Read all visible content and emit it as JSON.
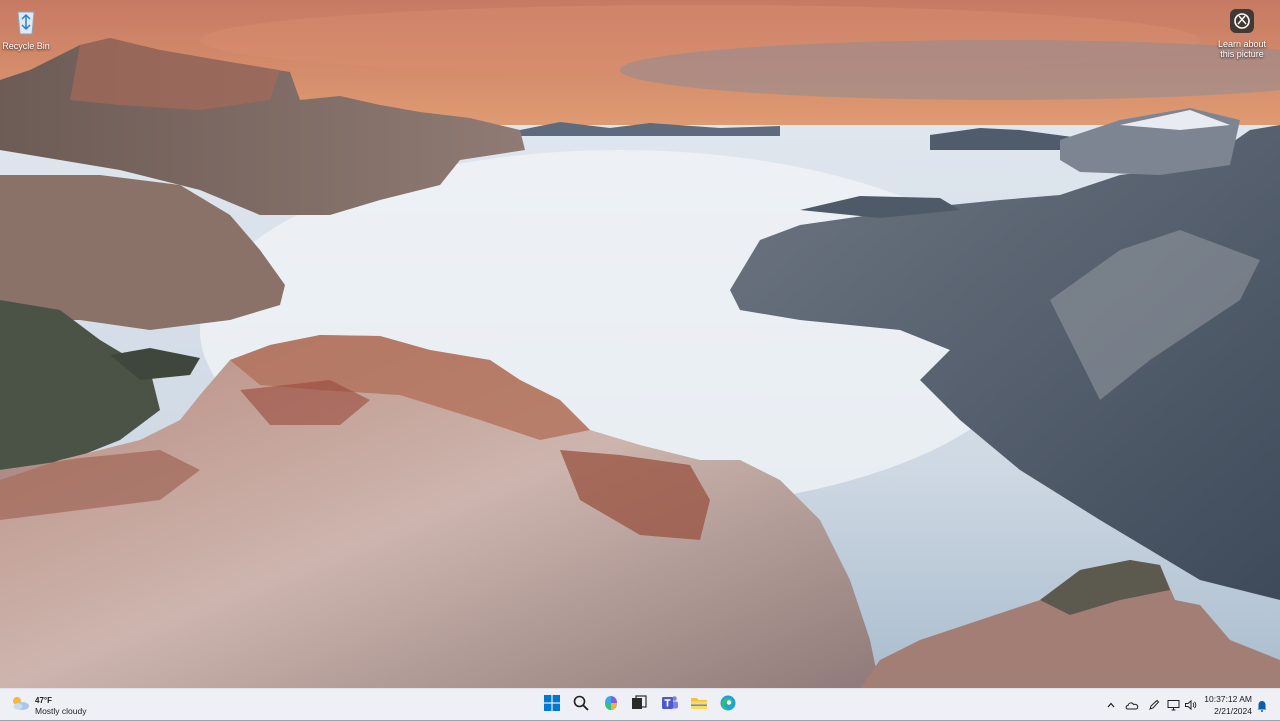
{
  "desktop": {
    "icons": [
      {
        "label": "Recycle Bin",
        "icon": "recycle-bin-icon"
      },
      {
        "label": "Learn about this picture",
        "icon": "camera-lens-icon"
      }
    ]
  },
  "taskbar": {
    "weather": {
      "temp": "47°F",
      "condition": "Mostly cloudy",
      "icon": "partly-cloudy-icon"
    },
    "apps": [
      {
        "name": "start",
        "icon": "windows-logo-icon"
      },
      {
        "name": "search",
        "icon": "search-icon"
      },
      {
        "name": "copilot",
        "icon": "copilot-icon"
      },
      {
        "name": "task-view",
        "icon": "task-view-icon"
      },
      {
        "name": "teams",
        "icon": "teams-icon"
      },
      {
        "name": "file-explorer",
        "icon": "folder-icon"
      },
      {
        "name": "edge",
        "icon": "edge-icon"
      }
    ],
    "tray": {
      "icons": [
        "chevron-up-icon",
        "onedrive-icon",
        "pen-icon",
        "network-icon",
        "volume-icon"
      ]
    },
    "clock": {
      "time": "10:37:12 AM",
      "date": "2/21/2024"
    },
    "notification_icon": "bell-icon"
  },
  "colors": {
    "taskbar_bg": "#eef0f5",
    "start_blue": "#0078d4",
    "teams_purple": "#5059c9",
    "folder_yellow": "#f5c242"
  }
}
